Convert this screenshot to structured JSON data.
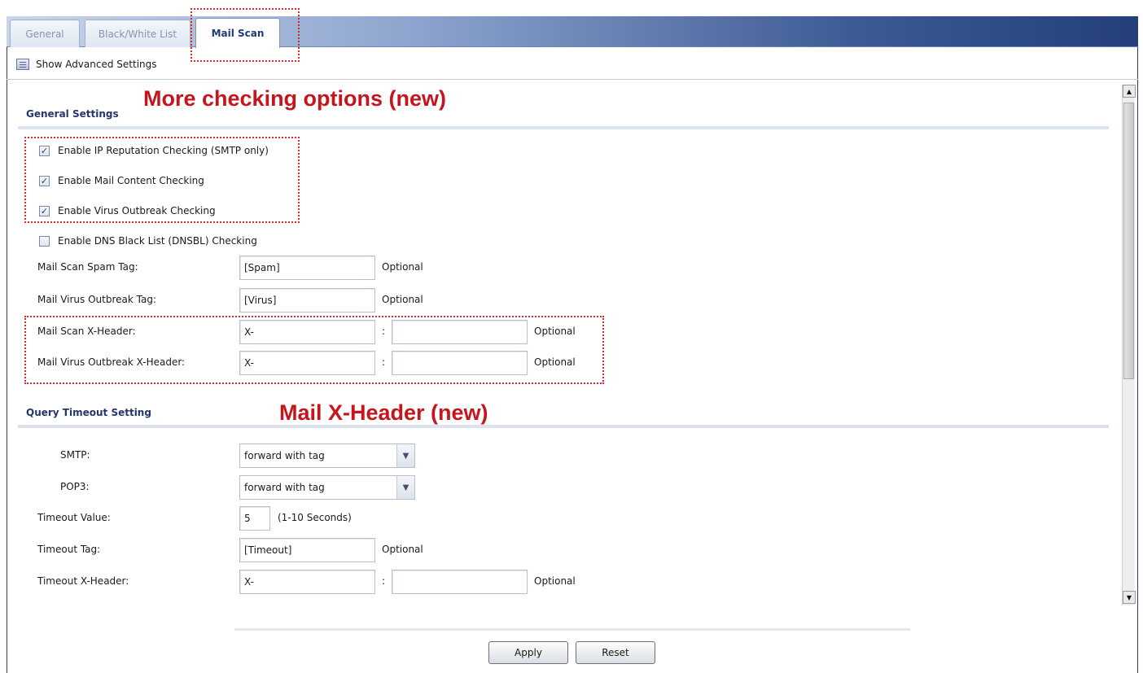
{
  "tabs": [
    {
      "label": "General"
    },
    {
      "label": "Black/White List"
    },
    {
      "label": "Mail Scan"
    }
  ],
  "advanced": {
    "label": "Show Advanced Settings"
  },
  "annotations": {
    "checking": "More checking options (new)",
    "xheader": "Mail X-Header (new)"
  },
  "general_settings": {
    "heading": "General Settings",
    "checkboxes": [
      {
        "label": "Enable IP Reputation Checking (SMTP only)",
        "checked": true
      },
      {
        "label": "Enable Mail Content Checking",
        "checked": true
      },
      {
        "label": "Enable Virus Outbreak Checking",
        "checked": true
      },
      {
        "label": "Enable DNS Black List (DNSBL) Checking",
        "checked": false
      }
    ],
    "spam_tag": {
      "label": "Mail Scan Spam Tag:",
      "value": "[Spam]",
      "hint": "Optional"
    },
    "virus_tag": {
      "label": "Mail Virus Outbreak Tag:",
      "value": "[Virus]",
      "hint": "Optional"
    },
    "scan_xheader": {
      "label": "Mail Scan X-Header:",
      "name": "X-",
      "value": "",
      "hint": "Optional"
    },
    "virus_xheader": {
      "label": "Mail Virus Outbreak X-Header:",
      "name": "X-",
      "value": "",
      "hint": "Optional"
    }
  },
  "query_timeout": {
    "heading": "Query Timeout Setting",
    "smtp": {
      "label": "SMTP:",
      "value": "forward with tag"
    },
    "pop3": {
      "label": "POP3:",
      "value": "forward with tag"
    },
    "timeout_value": {
      "label": "Timeout Value:",
      "value": "5",
      "hint": "(1-10 Seconds)"
    },
    "timeout_tag": {
      "label": "Timeout Tag:",
      "value": "[Timeout]",
      "hint": "Optional"
    },
    "timeout_xheader": {
      "label": "Timeout X-Header:",
      "name": "X-",
      "value": "",
      "hint": "Optional"
    }
  },
  "buttons": {
    "apply": "Apply",
    "reset": "Reset"
  },
  "colon": ":"
}
